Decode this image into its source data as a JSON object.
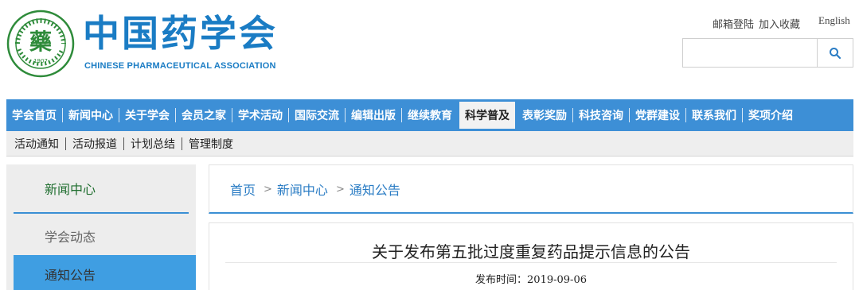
{
  "header": {
    "logo_year": "1907",
    "brand_cn": "中国药学会",
    "brand_en": "CHINESE PHARMACEUTICAL ASSOCIATION",
    "links": [
      "邮箱登陆",
      "加入收藏"
    ],
    "english_label": "English",
    "search_placeholder": ""
  },
  "nav": {
    "items": [
      {
        "label": "学会首页"
      },
      {
        "label": "新闻中心"
      },
      {
        "label": "关于学会"
      },
      {
        "label": "会员之家"
      },
      {
        "label": "学术活动"
      },
      {
        "label": "国际交流"
      },
      {
        "label": "编辑出版"
      },
      {
        "label": "继续教育"
      },
      {
        "label": "科学普及",
        "active": true
      },
      {
        "label": "表彰奖励"
      },
      {
        "label": "科技咨询"
      },
      {
        "label": "党群建设"
      },
      {
        "label": "联系我们"
      },
      {
        "label": "奖项介绍"
      }
    ]
  },
  "subnav": {
    "items": [
      "活动通知",
      "活动报道",
      "计划总结",
      "管理制度"
    ]
  },
  "sidebar": {
    "title": "新闻中心",
    "items": [
      "学会动态",
      "通知公告"
    ]
  },
  "breadcrumb": {
    "home": "首页",
    "level1": "新闻中心",
    "level2": "通知公告",
    "separator": ">"
  },
  "article": {
    "title": "关于发布第五批过度重复药品提示信息的公告",
    "meta_label": "发布时间：",
    "meta_date": "2019-09-06"
  },
  "colors": {
    "brand_blue": "#1a7cc4",
    "nav_blue": "#3d8fd6",
    "logo_green": "#2e8b3a"
  }
}
